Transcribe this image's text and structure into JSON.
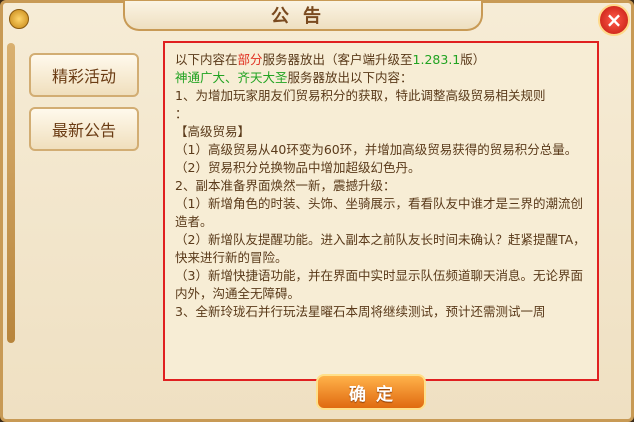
{
  "dialog": {
    "title": "公告",
    "close_label": "×",
    "confirm_label": "确定"
  },
  "sidebar": {
    "items": [
      {
        "label": "精彩活动"
      },
      {
        "label": "最新公告"
      }
    ]
  },
  "announcement": {
    "line1_prefix": "以下内容在",
    "line1_highlight": "部分",
    "line1_mid": "服务器放出（客户端升级至",
    "line1_version": "1.283.1",
    "line1_suffix": "版）",
    "line2": "神通广大、齐天大圣",
    "line2_suffix": "服务器放出以下内容：",
    "line3": "1、为增加玩家朋友们贸易积分的获取，特此调整高级贸易相关规则",
    "line4": "：",
    "line5": "【高级贸易】",
    "line6": "（1）高级贸易从40环变为60环，并增加高级贸易获得的贸易积分总量。",
    "line7": "（2）贸易积分兑换物品中增加超级幻色丹。",
    "line8": "2、副本准备界面焕然一新，震撼升级：",
    "line9": "（1）新增角色的时装、头饰、坐骑展示，看看队友中谁才是三界的潮流创造者。",
    "line10": "（2）新增队友提醒功能。进入副本之前队友长时间未确认？赶紧提醒TA，快来进行新的冒险。",
    "line11": "（3）新增快捷语功能，并在界面中实时显示队伍频道聊天消息。无论界面内外，沟通全无障碍。",
    "line12": "3、全新玲珑石并行玩法星曜石本周将继续测试，预计还需测试一周"
  },
  "colors": {
    "highlight_red": "#e03020",
    "highlight_green": "#21a321",
    "content_border": "#e02020"
  }
}
